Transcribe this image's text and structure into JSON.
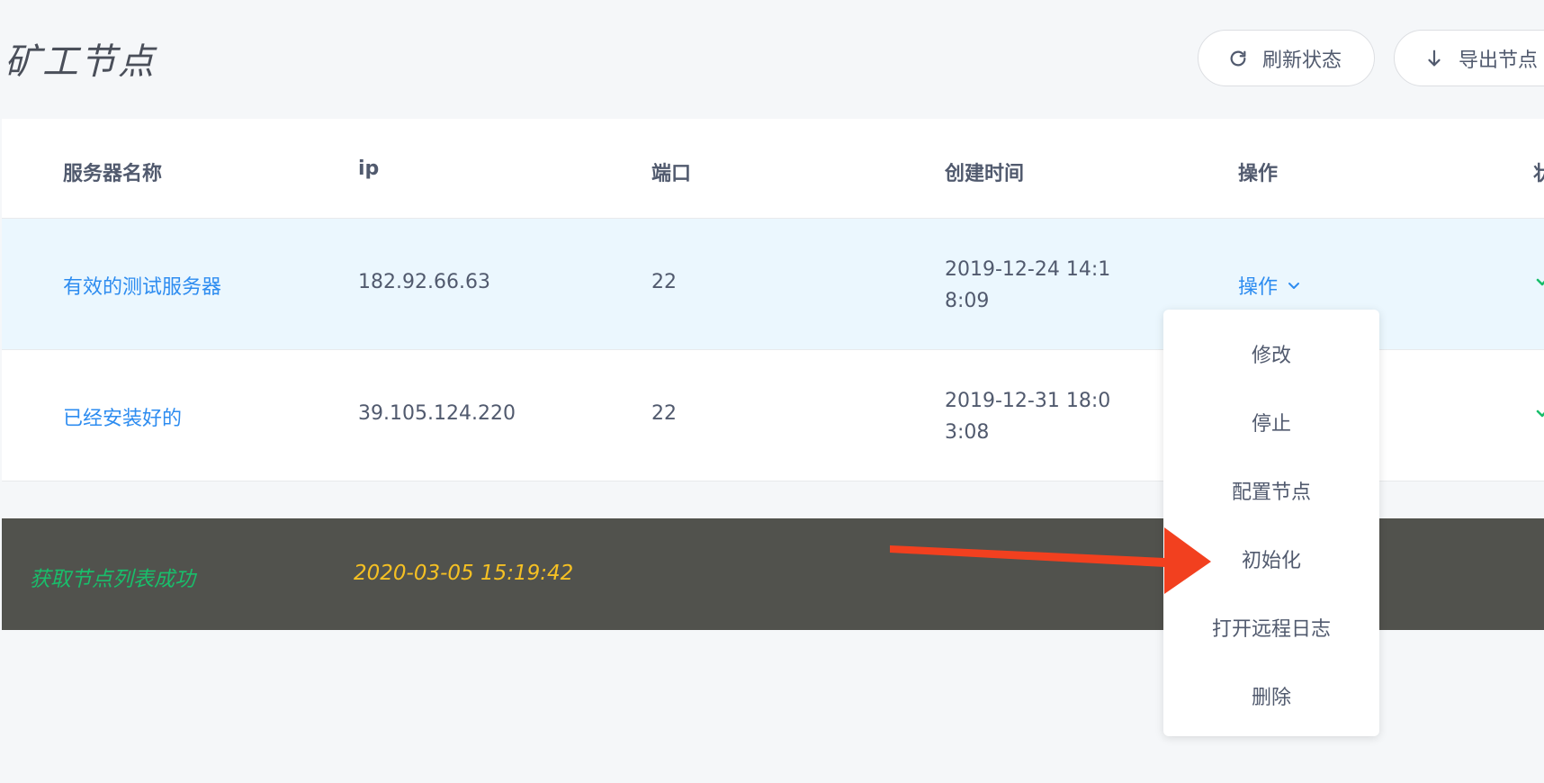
{
  "page": {
    "title": "矿工节点"
  },
  "toolbar": {
    "refresh_label": "刷新状态",
    "export_label": "导出节点"
  },
  "table": {
    "columns": [
      "服务器名称",
      "ip",
      "端口",
      "创建时间",
      "操作",
      "状"
    ],
    "rows": [
      {
        "name": "有效的测试服务器",
        "ip": "182.92.66.63",
        "port": "22",
        "created": "2019-12-24 14:18:09",
        "action": "操作",
        "status": "check"
      },
      {
        "name": "已经安装好的",
        "ip": "39.105.124.220",
        "port": "22",
        "created": "2019-12-31 18:03:08",
        "status": "check"
      }
    ]
  },
  "dropdown": {
    "items": [
      "修改",
      "停止",
      "配置节点",
      "初始化",
      "打开远程日志",
      "删除"
    ]
  },
  "log": {
    "message": "获取节点列表成功",
    "time": "2020-03-05 15:19:42"
  },
  "colors": {
    "link": "#2d8cf0",
    "hover_row": "#ebf7fe",
    "log_background": "#51524d",
    "log_success": "#19be6b",
    "log_time": "#f5c023",
    "annotation_arrow": "#f2401f",
    "status_check": "#19be6b"
  },
  "icons": {
    "refresh": "refresh-icon",
    "export": "arrow-down-icon",
    "ops_dropdown": "chevron-down-icon",
    "status": "check-icon",
    "annotation": "red-arrow-icon"
  }
}
